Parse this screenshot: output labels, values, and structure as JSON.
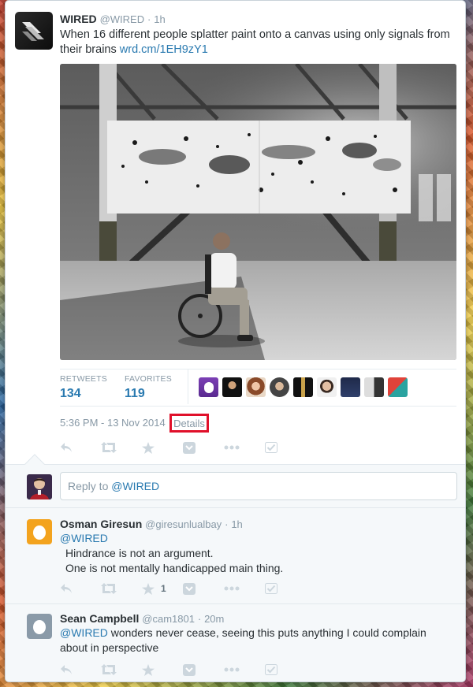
{
  "tweet": {
    "author_name": "WIRED",
    "author_handle": "@WIRED",
    "separator": "·",
    "age": "1h",
    "text": "When 16 different people splatter paint onto a canvas using only signals from their brains ",
    "link": "wrd.cm/1EH9zY1",
    "stats": {
      "retweets_label": "RETWEETS",
      "retweets_value": "134",
      "favorites_label": "FAVORITES",
      "favorites_value": "119"
    },
    "timestamp": "5:36 PM - 13 Nov 2014",
    "details_label": "Details",
    "highlight_color": "#e0102a",
    "link_color": "#2a7ab0"
  },
  "reply_box": {
    "placeholder_prefix": "Reply to ",
    "placeholder_handle": "@WIRED"
  },
  "replies": [
    {
      "name": "Osman Giresun",
      "handle": "@giresunlualbay",
      "separator": "·",
      "age": "1h",
      "mention": "@WIRED",
      "line1": "Hindrance is not an argument.",
      "line2": "One is not mentally handicapped main thing.",
      "favorite_count": "1"
    },
    {
      "name": "Sean Campbell",
      "handle": "@cam1801",
      "separator": "·",
      "age": "20m",
      "mention": "@WIRED",
      "text": " wonders never cease, seeing this puts anything I could complain about in perspective"
    }
  ]
}
